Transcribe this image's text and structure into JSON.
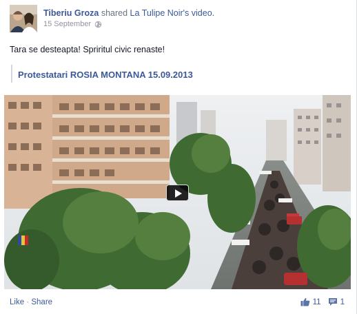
{
  "post": {
    "author": "Tiberiu Groza",
    "verb": "shared",
    "shared_from": "La Tulipe Noir's video.",
    "date": "15 September",
    "text": "Tara se desteapta! Spriritul civic renaste!",
    "video_title": "Protestatari ROSIA MONTANA 15.09.2013"
  },
  "footer": {
    "like": "Like",
    "separator": "·",
    "share": "Share",
    "like_count": "11",
    "comment_count": "1"
  },
  "icons": {
    "audience": "globe-icon",
    "play": "play-icon",
    "likes": "thumbs-up-icon",
    "comments": "comment-icon"
  },
  "colors": {
    "link": "#3b5998",
    "meta": "#90949c",
    "text": "#141823"
  }
}
